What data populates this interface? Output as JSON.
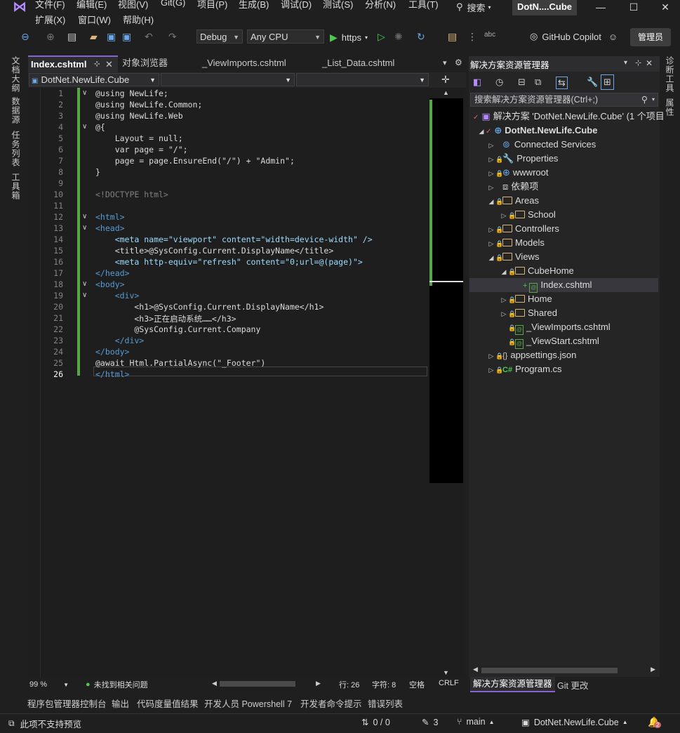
{
  "menu": {
    "row1": [
      "文件(F)",
      "编辑(E)",
      "视图(V)",
      "Git(G)",
      "项目(P)",
      "生成(B)",
      "调试(D)",
      "测试(S)",
      "分析(N)",
      "工具(T)"
    ],
    "row2": [
      "扩展(X)",
      "窗口(W)",
      "帮助(H)"
    ],
    "search": "搜索",
    "solution_title": "DotN....Cube"
  },
  "toolbar": {
    "config": "Debug",
    "platform": "Any CPU",
    "run_target": "https",
    "copilot": "GitHub Copilot",
    "admin": "管理员"
  },
  "left_strip": [
    "文档大纲",
    "数据源",
    "任务列表",
    "工具箱"
  ],
  "right_strip": [
    "诊断工具",
    "属性"
  ],
  "editor": {
    "tabs": [
      "Index.cshtml",
      "对象浏览器",
      "_ViewImports.cshtml",
      "_List_Data.cshtml"
    ],
    "project_combo": "DotNet.NewLife.Cube",
    "lines": [
      {
        "n": "1",
        "t": "@using NewLife;"
      },
      {
        "n": "2",
        "t": "@using NewLife.Common;"
      },
      {
        "n": "3",
        "t": "@using NewLife.Web"
      },
      {
        "n": "4",
        "t": "@{"
      },
      {
        "n": "5",
        "t": "    Layout = null;"
      },
      {
        "n": "6",
        "t": "    var page = \"/\";"
      },
      {
        "n": "7",
        "t": "    page = page.EnsureEnd(\"/\") + \"Admin\";"
      },
      {
        "n": "8",
        "t": "}"
      },
      {
        "n": "9",
        "t": ""
      },
      {
        "n": "10",
        "t": "<!DOCTYPE html>"
      },
      {
        "n": "11",
        "t": ""
      },
      {
        "n": "12",
        "t": "<html>"
      },
      {
        "n": "13",
        "t": "<head>"
      },
      {
        "n": "14",
        "t": "    <meta name=\"viewport\" content=\"width=device-width\" />"
      },
      {
        "n": "15",
        "t": "    <title>@SysConfig.Current.DisplayName</title>"
      },
      {
        "n": "16",
        "t": "    <meta http-equiv=\"refresh\" content=\"0;url=@(page)\">"
      },
      {
        "n": "17",
        "t": "</head>"
      },
      {
        "n": "18",
        "t": "<body>"
      },
      {
        "n": "19",
        "t": "    <div>"
      },
      {
        "n": "20",
        "t": "        <h1>@SysConfig.Current.DisplayName</h1>"
      },
      {
        "n": "21",
        "t": "        <h3>正在启动系统……</h3>"
      },
      {
        "n": "22",
        "t": "        @SysConfig.Current.Company"
      },
      {
        "n": "23",
        "t": "    </div>"
      },
      {
        "n": "24",
        "t": "</body>"
      },
      {
        "n": "25",
        "t": "@await Html.PartialAsync(\"_Footer\")"
      },
      {
        "n": "26",
        "t": "</html>"
      }
    ],
    "zoom": "99 %",
    "issues": "未找到相关问题",
    "line_pos": "行: 26",
    "char_pos": "字符: 8",
    "whitespace": "空格",
    "eol": "CRLF"
  },
  "solution_explorer": {
    "title": "解决方案资源管理器",
    "search_placeholder": "搜索解决方案资源管理器(Ctrl+;)",
    "tree": [
      {
        "label": "解决方案 'DotNet.NewLife.Cube' (1 个项目"
      },
      {
        "label": "DotNet.NewLife.Cube"
      },
      {
        "label": "Connected Services"
      },
      {
        "label": "Properties"
      },
      {
        "label": "wwwroot"
      },
      {
        "label": "依赖项"
      },
      {
        "label": "Areas"
      },
      {
        "label": "School"
      },
      {
        "label": "Controllers"
      },
      {
        "label": "Models"
      },
      {
        "label": "Views"
      },
      {
        "label": "CubeHome"
      },
      {
        "label": "Index.cshtml"
      },
      {
        "label": "Home"
      },
      {
        "label": "Shared"
      },
      {
        "label": "_ViewImports.cshtml"
      },
      {
        "label": "_ViewStart.cshtml"
      },
      {
        "label": "appsettings.json"
      },
      {
        "label": "Program.cs"
      }
    ],
    "bottom_tabs": [
      "解决方案资源管理器",
      "Git 更改"
    ]
  },
  "bottom_tabs": [
    "程序包管理器控制台",
    "输出",
    "代码度量值结果",
    "开发人员 Powershell 7",
    "开发者命令提示",
    "错误列表"
  ],
  "status": {
    "message": "此项不支持预览",
    "git_changes": "0 / 0",
    "edits": "3",
    "branch": "main",
    "repo": "DotNet.NewLife.Cube",
    "notifications": "2"
  },
  "colors": {
    "accent": "#8a63d2",
    "green": "#57a64a",
    "keyword": "#569cd6"
  }
}
